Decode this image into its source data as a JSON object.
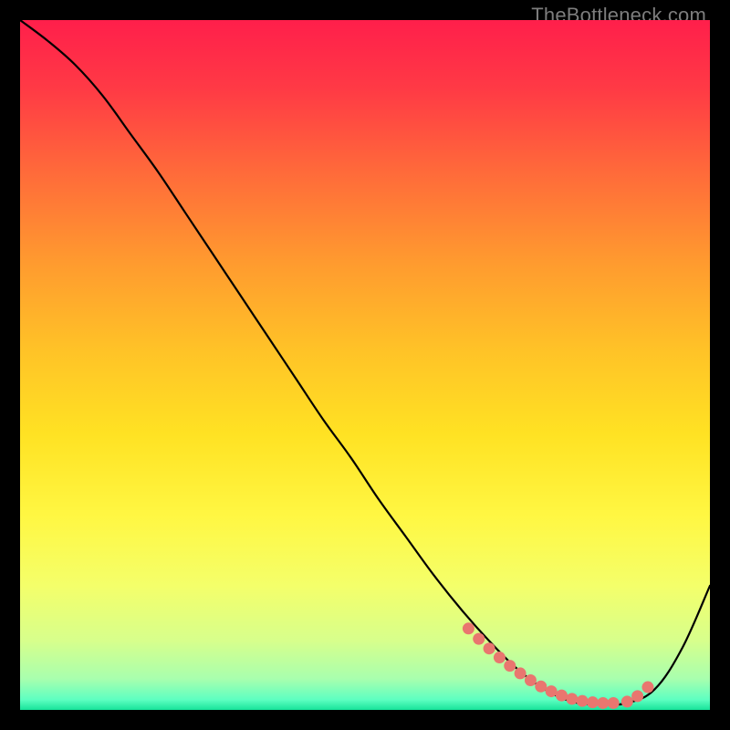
{
  "watermark": "TheBottleneck.com",
  "chart_data": {
    "type": "line",
    "title": "",
    "xlabel": "",
    "ylabel": "",
    "xlim": [
      0,
      100
    ],
    "ylim": [
      0,
      100
    ],
    "grid": false,
    "series": [
      {
        "name": "curve",
        "x": [
          0,
          4,
          8,
          12,
          16,
          20,
          24,
          28,
          32,
          36,
          40,
          44,
          48,
          52,
          56,
          60,
          64,
          68,
          72,
          76,
          80,
          84,
          88,
          92,
          96,
          100
        ],
        "y": [
          100,
          97,
          93.5,
          89,
          83.5,
          78,
          72,
          66,
          60,
          54,
          48,
          42,
          36.5,
          30.5,
          25,
          19.5,
          14.5,
          10,
          6,
          3,
          1.2,
          0.8,
          1.0,
          3,
          9,
          18
        ]
      }
    ],
    "markers": {
      "name": "dots",
      "x": [
        65,
        66.5,
        68,
        69.5,
        71,
        72.5,
        74,
        75.5,
        77,
        78.5,
        80,
        81.5,
        83,
        84.5,
        86,
        88,
        89.5,
        91
      ],
      "y": [
        11.8,
        10.3,
        8.9,
        7.6,
        6.4,
        5.3,
        4.3,
        3.4,
        2.7,
        2.1,
        1.6,
        1.3,
        1.1,
        1.0,
        1.0,
        1.2,
        2.0,
        3.3
      ]
    },
    "gradient_stops": [
      {
        "offset": 0.0,
        "color": "#ff1f4b"
      },
      {
        "offset": 0.1,
        "color": "#ff3a45"
      },
      {
        "offset": 0.22,
        "color": "#ff6a3a"
      },
      {
        "offset": 0.35,
        "color": "#ff9a2f"
      },
      {
        "offset": 0.48,
        "color": "#ffc327"
      },
      {
        "offset": 0.6,
        "color": "#ffe223"
      },
      {
        "offset": 0.72,
        "color": "#fff743"
      },
      {
        "offset": 0.82,
        "color": "#f4ff6a"
      },
      {
        "offset": 0.9,
        "color": "#d7ff8c"
      },
      {
        "offset": 0.955,
        "color": "#a8ffae"
      },
      {
        "offset": 0.985,
        "color": "#5effc1"
      },
      {
        "offset": 1.0,
        "color": "#17e39a"
      }
    ]
  }
}
